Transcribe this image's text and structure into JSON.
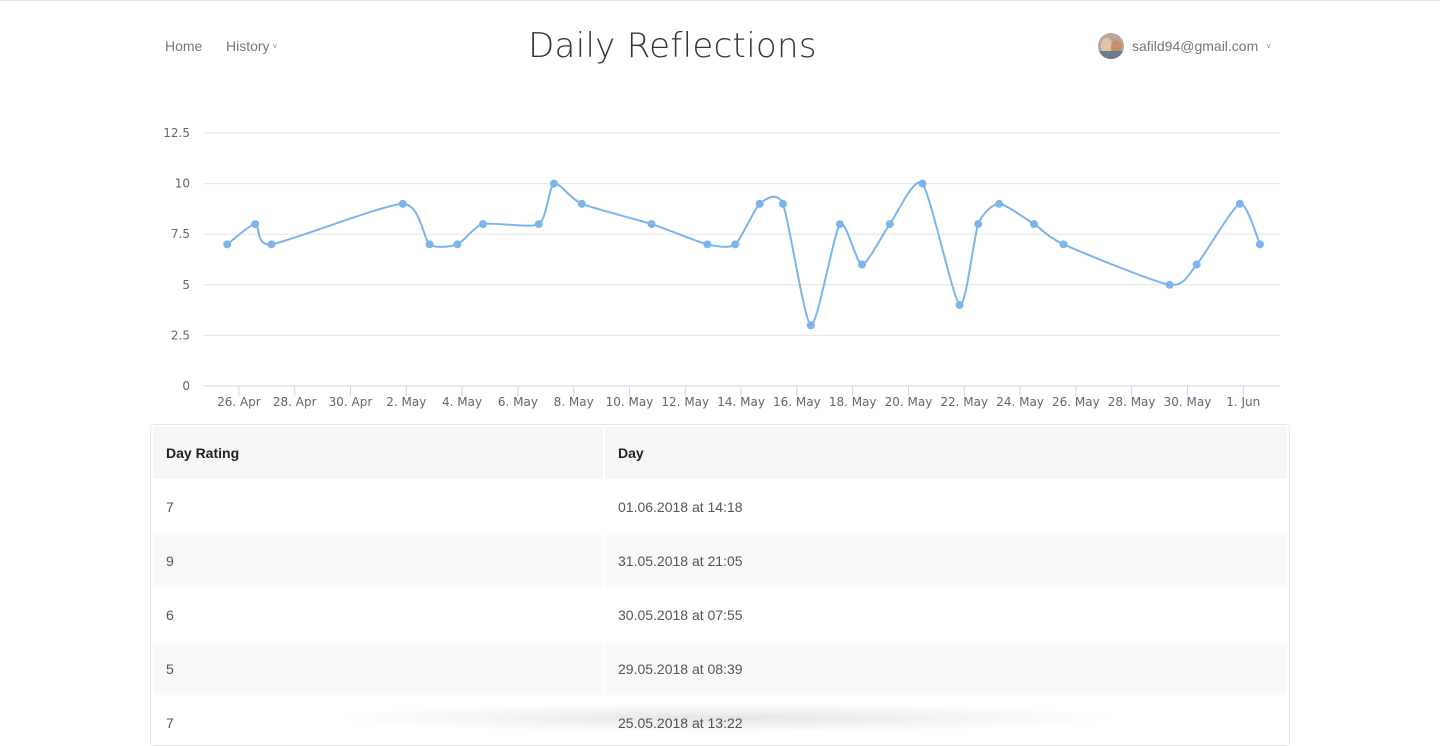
{
  "nav": {
    "home": "Home",
    "history": "History"
  },
  "title": "Daily Reflections",
  "user": {
    "email": "safild94@gmail.com"
  },
  "chart_data": {
    "type": "line",
    "title": "",
    "xlabel": "",
    "ylabel": "",
    "x_range": [
      "2018-04-25",
      "2018-06-01"
    ],
    "ylim": [
      0,
      12.5
    ],
    "yticks": [
      0,
      2.5,
      5,
      7.5,
      10,
      12.5
    ],
    "ytick_labels": [
      "0",
      "2.5",
      "5",
      "7.5",
      "10",
      "12.5"
    ],
    "xticks": [
      "2018-04-26",
      "2018-04-28",
      "2018-04-30",
      "2018-05-02",
      "2018-05-04",
      "2018-05-06",
      "2018-05-08",
      "2018-05-10",
      "2018-05-12",
      "2018-05-14",
      "2018-05-16",
      "2018-05-18",
      "2018-05-20",
      "2018-05-22",
      "2018-05-24",
      "2018-05-26",
      "2018-05-28",
      "2018-05-30",
      "2018-06-01"
    ],
    "xtick_labels": [
      "26. Apr",
      "28. Apr",
      "30. Apr",
      "2. May",
      "4. May",
      "6. May",
      "8. May",
      "10. May",
      "12. May",
      "14. May",
      "16. May",
      "18. May",
      "20. May",
      "22. May",
      "24. May",
      "26. May",
      "28. May",
      "30. May",
      "1. Jun"
    ],
    "grid": true,
    "color": "#7cb5ec",
    "series": [
      {
        "points": [
          {
            "x": "2018-04-25T14:00",
            "y": 7
          },
          {
            "x": "2018-04-26T14:00",
            "y": 8
          },
          {
            "x": "2018-04-27T04:00",
            "y": 7
          },
          {
            "x": "2018-05-01T21:00",
            "y": 9
          },
          {
            "x": "2018-05-02T20:00",
            "y": 7
          },
          {
            "x": "2018-05-03T20:00",
            "y": 7
          },
          {
            "x": "2018-05-04T18:00",
            "y": 8
          },
          {
            "x": "2018-05-06T18:00",
            "y": 8
          },
          {
            "x": "2018-05-07T07:00",
            "y": 10
          },
          {
            "x": "2018-05-08T07:00",
            "y": 9
          },
          {
            "x": "2018-05-10T19:00",
            "y": 8
          },
          {
            "x": "2018-05-12T19:00",
            "y": 7
          },
          {
            "x": "2018-05-13T19:00",
            "y": 7
          },
          {
            "x": "2018-05-14T16:00",
            "y": 9
          },
          {
            "x": "2018-05-15T12:00",
            "y": 9
          },
          {
            "x": "2018-05-16T12:00",
            "y": 3
          },
          {
            "x": "2018-05-17T13:00",
            "y": 8
          },
          {
            "x": "2018-05-18T08:00",
            "y": 6
          },
          {
            "x": "2018-05-19T08:00",
            "y": 8
          },
          {
            "x": "2018-05-20T12:00",
            "y": 10
          },
          {
            "x": "2018-05-21T20:00",
            "y": 4
          },
          {
            "x": "2018-05-22T12:00",
            "y": 8
          },
          {
            "x": "2018-05-23T06:00",
            "y": 9
          },
          {
            "x": "2018-05-24T12:00",
            "y": 8
          },
          {
            "x": "2018-05-25T13:22",
            "y": 7
          },
          {
            "x": "2018-05-29T08:39",
            "y": 5
          },
          {
            "x": "2018-05-30T07:55",
            "y": 6
          },
          {
            "x": "2018-05-31T21:05",
            "y": 9
          },
          {
            "x": "2018-06-01T14:18",
            "y": 7
          }
        ]
      }
    ]
  },
  "table": {
    "headers": [
      "Day Rating",
      "Day"
    ],
    "rows": [
      {
        "rating": "7",
        "day": "01.06.2018 at 14:18"
      },
      {
        "rating": "9",
        "day": "31.05.2018 at 21:05"
      },
      {
        "rating": "6",
        "day": "30.05.2018 at 07:55"
      },
      {
        "rating": "5",
        "day": "29.05.2018 at 08:39"
      },
      {
        "rating": "7",
        "day": "25.05.2018 at 13:22"
      }
    ]
  }
}
